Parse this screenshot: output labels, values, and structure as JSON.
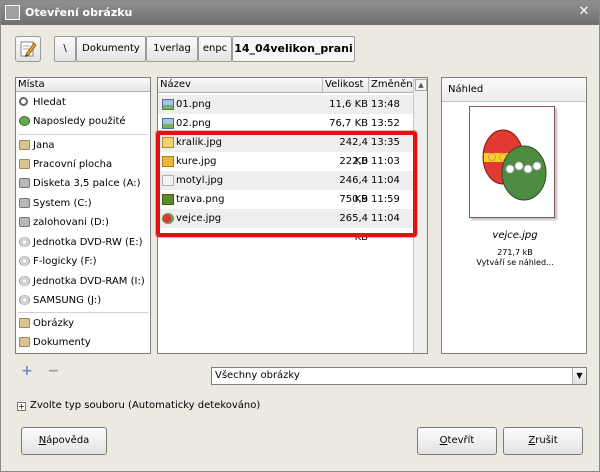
{
  "window": {
    "title": "Otevření obrázku",
    "close_glyph": "✕"
  },
  "toolbar": {
    "edit_icon": "pencil-icon"
  },
  "path": {
    "root": "\\",
    "segments": [
      "Dokumenty",
      "1verlag",
      "enpc",
      "14_04velikon_prani"
    ]
  },
  "places": {
    "header": "Místa",
    "items": [
      {
        "label": "Hledat",
        "icon": "search"
      },
      {
        "label": "Naposledy použité",
        "icon": "recent"
      },
      {
        "label": "Jana",
        "icon": "folder"
      },
      {
        "label": "Pracovní plocha",
        "icon": "folder"
      },
      {
        "label": "Disketa 3,5 palce (A:)",
        "icon": "drive"
      },
      {
        "label": "System (C:)",
        "icon": "drive"
      },
      {
        "label": "zalohovani (D:)",
        "icon": "drive"
      },
      {
        "label": "Jednotka DVD-RW (E:)",
        "icon": "disc"
      },
      {
        "label": "F-logicky (F:)",
        "icon": "disc"
      },
      {
        "label": "Jednotka DVD-RAM (I:)",
        "icon": "disc"
      },
      {
        "label": "SAMSUNG (J:)",
        "icon": "disc"
      },
      {
        "label": "Obrázky",
        "icon": "folder"
      },
      {
        "label": "Dokumenty",
        "icon": "folder"
      }
    ],
    "add_glyph": "+",
    "remove_glyph": "−"
  },
  "files": {
    "columns": {
      "name": "Název",
      "size": "Velikost",
      "modified": "Změněno"
    },
    "rows": [
      {
        "name": "01.png",
        "size": "11,6 KB",
        "modified": "13:48"
      },
      {
        "name": "02.png",
        "size": "76,7 KB",
        "modified": "13:52"
      },
      {
        "name": "kralik.jpg",
        "size": "242,4 KB",
        "modified": "13:35"
      },
      {
        "name": "kure.jpg",
        "size": "222,0 KB",
        "modified": "11:03"
      },
      {
        "name": "motyl.jpg",
        "size": "246,4 KB",
        "modified": "11:04"
      },
      {
        "name": "trava.png",
        "size": "750,9 KB",
        "modified": "11:59"
      },
      {
        "name": "vejce.jpg",
        "size": "265,4 KB",
        "modified": "11:04"
      }
    ],
    "highlight_color": "#e01212"
  },
  "preview": {
    "header": "Náhled",
    "file_name": "vejce.jpg",
    "file_size": "271,7 kB",
    "status": "Vytváří se náhled..."
  },
  "filter": {
    "value": "Všechny obrázky",
    "dropdown_glyph": "▼"
  },
  "file_type": {
    "toggle_glyph": "+",
    "label": "Zvolte typ souboru (Automaticky detekováno)"
  },
  "buttons": {
    "help": {
      "accel": "N",
      "rest": "ápověda"
    },
    "open": {
      "accel": "O",
      "rest": "tevřít"
    },
    "cancel": {
      "accel": "Z",
      "rest": "rušit"
    }
  }
}
